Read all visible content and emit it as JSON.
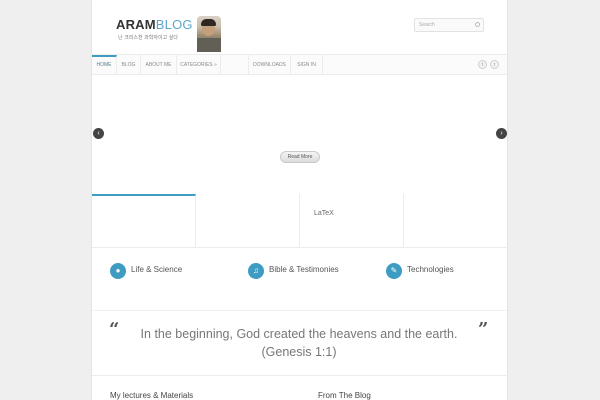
{
  "header": {
    "logo_bold": "ARAM",
    "logo_light": "BLOG",
    "tagline": "난 크리스천 과학자이고 싶다",
    "search_placeholder": "Search"
  },
  "nav": {
    "items": [
      "HOME",
      "BLOG",
      "ABOUT ME",
      "CATEGORIES »",
      "",
      "DOWNLOADS",
      "SIGN IN"
    ]
  },
  "slider": {
    "read_more": "Read More",
    "prev_icon": "chevron-left-icon",
    "next_icon": "chevron-right-icon"
  },
  "tabs": {
    "items": [
      "",
      "",
      "LaTeX",
      ""
    ]
  },
  "features": [
    {
      "label": "Life & Science",
      "icon": "chat-bubble-icon"
    },
    {
      "label": "Bible & Testimonies",
      "icon": "music-note-icon"
    },
    {
      "label": "Technologies",
      "icon": "wrench-icon"
    }
  ],
  "quote": {
    "text": "In the beginning, God created the heavens and the earth. (Genesis 1:1)"
  },
  "bottom": {
    "left_title": "My lectures & Materials",
    "right_title": "From The Blog"
  },
  "colors": {
    "accent": "#3e9cc2",
    "background": "#efefef"
  }
}
